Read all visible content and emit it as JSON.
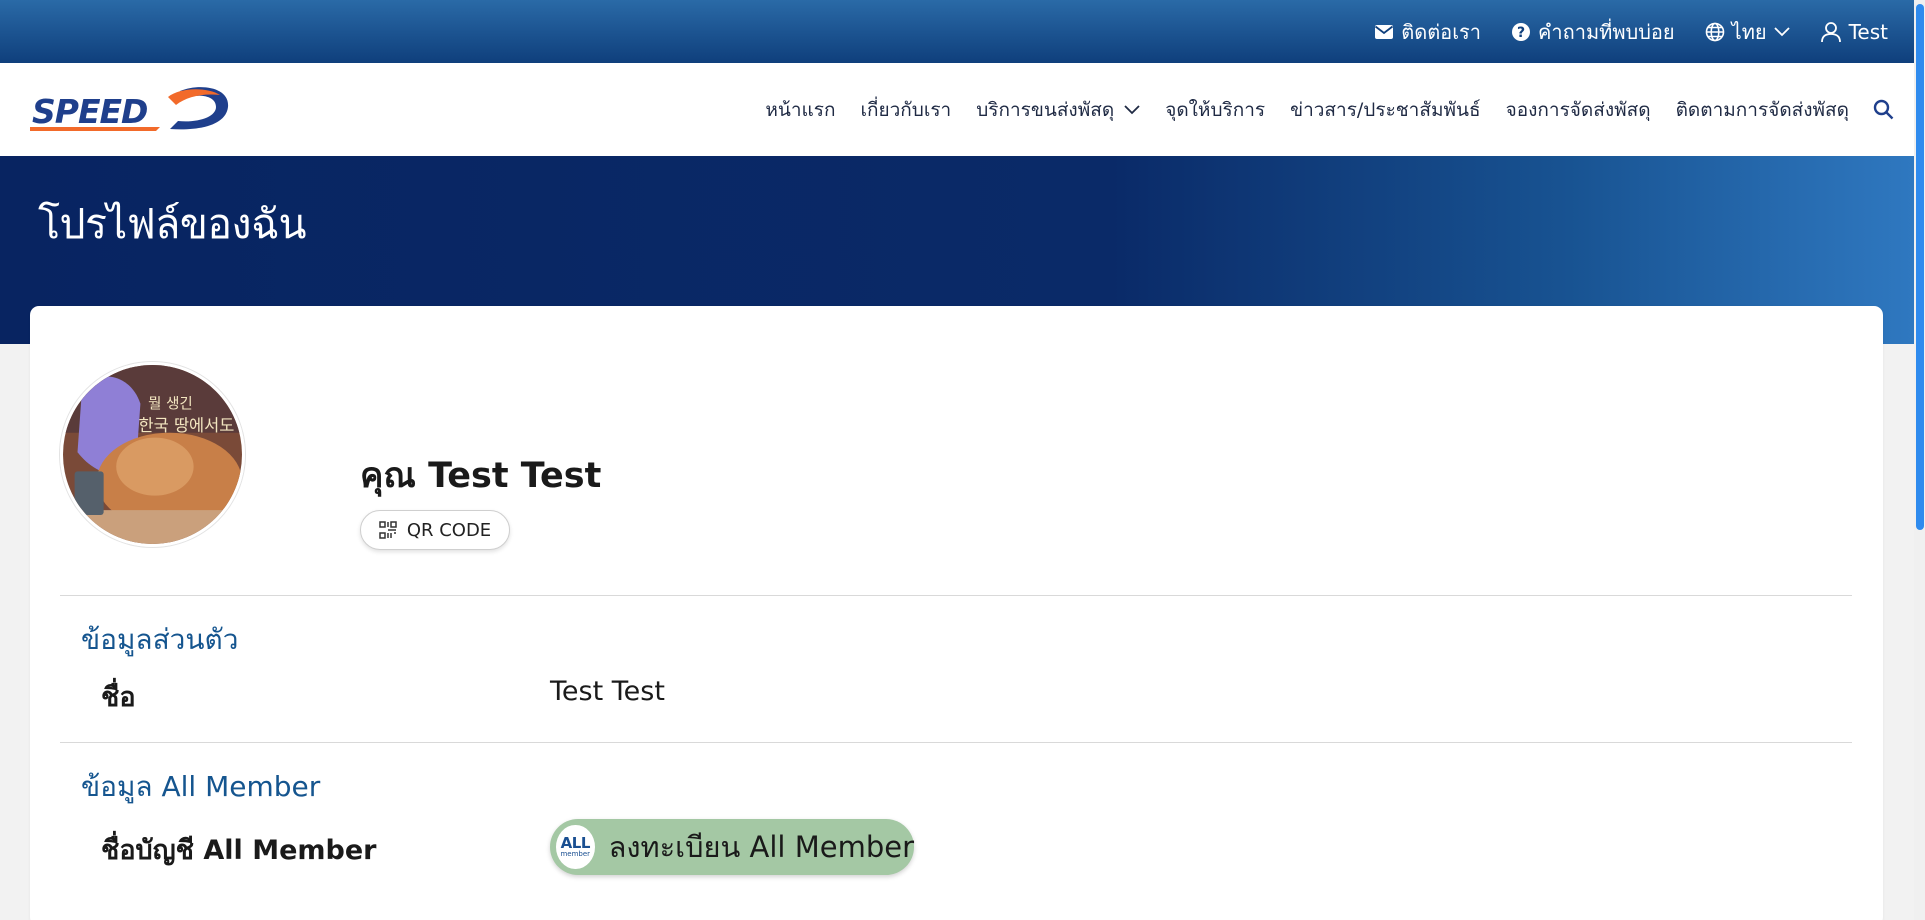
{
  "topbar": {
    "contact_label": "ติดต่อเรา",
    "faq_label": "คำถามที่พบบ่อย",
    "language_label": "ไทย",
    "user_label": "Test",
    "background_color": "#0f3f7c"
  },
  "navbar": {
    "logo_text": "SPEED-D",
    "items": [
      {
        "label": "หน้าแรก"
      },
      {
        "label": "เกี่ยวกับเรา"
      },
      {
        "label": "บริการขนส่งพัสดุ"
      },
      {
        "label": "จุดให้บริการ"
      },
      {
        "label": "ข่าวสาร/ประชาสัมพันธ์"
      },
      {
        "label": "จองการจัดส่งพัสดุ"
      },
      {
        "label": "ติดตามการจัดส่งพัสดุ"
      }
    ]
  },
  "banner": {
    "title": "โปรไฟล์ของฉัน"
  },
  "profile": {
    "name": "คุณ Test Test",
    "qr_label": "QR CODE"
  },
  "personal_info": {
    "title": "ข้อมูลส่วนตัว",
    "name_label": "ชื่อ",
    "name_value": "Test Test"
  },
  "all_member": {
    "title": "ข้อมูล All Member",
    "account_label": "ชื่อบัญชี All Member",
    "register_label": "ลงทะเบียน All Member",
    "logo_text": "ALL",
    "logo_subtext": "member",
    "button_color": "#a4c8a4"
  },
  "colors": {
    "accent": "#15558f",
    "banner": "#082461",
    "scroll_thumb": "#2f8bee"
  }
}
